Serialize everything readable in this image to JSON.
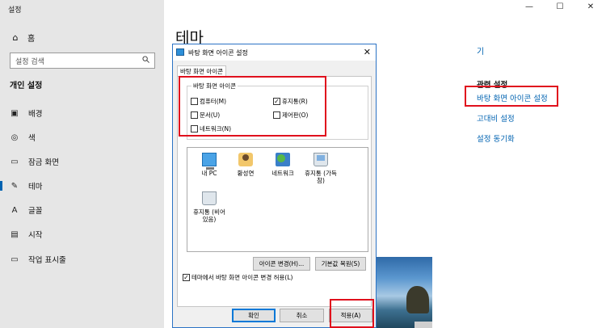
{
  "settings": {
    "app_title": "설정",
    "home_label": "홈",
    "search_placeholder": "설정 검색",
    "section_title": "개인 설정",
    "nav_items": [
      {
        "label": "배경",
        "icon": "image-icon"
      },
      {
        "label": "색",
        "icon": "palette-icon"
      },
      {
        "label": "잠금 화면",
        "icon": "lock-screen-icon"
      },
      {
        "label": "테마",
        "icon": "brush-icon"
      },
      {
        "label": "글꼴",
        "icon": "font-icon"
      },
      {
        "label": "시작",
        "icon": "start-icon"
      },
      {
        "label": "작업 표시줄",
        "icon": "taskbar-icon"
      }
    ],
    "active_item": "테마",
    "window_controls": {
      "minimize": "—",
      "maximize": "☐",
      "close": "✕"
    }
  },
  "main": {
    "page_title": "테마",
    "side_link_fragment": "기",
    "related_title": "관련 설정",
    "related_links": [
      "바탕 화면 아이콘 설정",
      "고대비 설정",
      "설정 동기화"
    ]
  },
  "dialog": {
    "title": "바탕 화면 아이콘 설정",
    "close": "✕",
    "tab": "바탕 화면 아이콘",
    "group_title": "바탕 화면 아이콘",
    "checkboxes": [
      {
        "label": "컴퓨터(M)",
        "checked": false
      },
      {
        "label": "휴지통(R)",
        "checked": true
      },
      {
        "label": "문서(U)",
        "checked": false
      },
      {
        "label": "제어판(O)",
        "checked": false
      },
      {
        "label": "네트워크(N)",
        "checked": false
      }
    ],
    "icons": [
      {
        "label": "내 PC",
        "icon": "pc-icon"
      },
      {
        "label": "황성연",
        "icon": "user-folder-icon"
      },
      {
        "label": "네트워크",
        "icon": "network-icon"
      },
      {
        "label": "휴지통 (가득 참)",
        "icon": "recycle-bin-full-icon"
      },
      {
        "label": "휴지통 (비어 있음)",
        "icon": "recycle-bin-empty-icon"
      }
    ],
    "change_icon_button": "아이콘 변경(H)...",
    "restore_default_button": "기본값 복원(S)",
    "allow_themes_label": "테마에서 바탕 화면 아이콘 변경 허용(L)",
    "allow_themes_checked": true,
    "ok_button": "확인",
    "cancel_button": "취소",
    "apply_button": "적용(A)"
  },
  "colors": {
    "accent": "#0063b1",
    "highlight": "#e0101d"
  }
}
